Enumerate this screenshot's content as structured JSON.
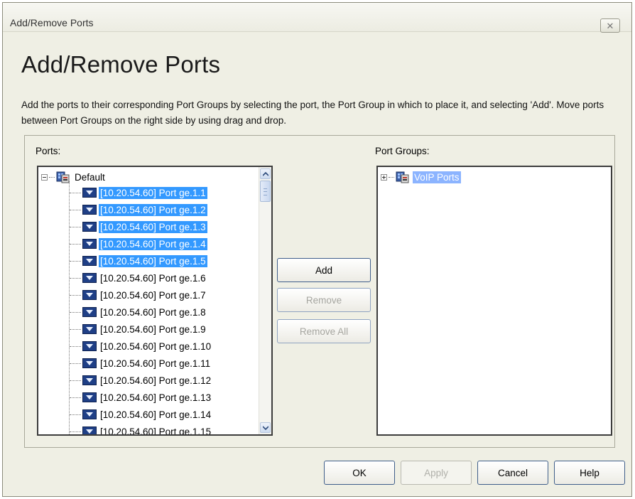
{
  "window": {
    "title": "Add/Remove Ports",
    "close_icon": "close-icon"
  },
  "heading": "Add/Remove Ports",
  "description": "Add the ports to their corresponding Port Groups by selecting the port, the Port Group in which to place it, and selecting 'Add'. Move ports between Port Groups on the right side by using drag and drop.",
  "ports_panel": {
    "label": "Ports:",
    "root": "Default",
    "items": [
      {
        "label": "[10.20.54.60] Port ge.1.1",
        "selected": true
      },
      {
        "label": "[10.20.54.60] Port ge.1.2",
        "selected": true
      },
      {
        "label": "[10.20.54.60] Port ge.1.3",
        "selected": true
      },
      {
        "label": "[10.20.54.60] Port ge.1.4",
        "selected": true
      },
      {
        "label": "[10.20.54.60] Port ge.1.5",
        "selected": true
      },
      {
        "label": "[10.20.54.60] Port ge.1.6",
        "selected": false
      },
      {
        "label": "[10.20.54.60] Port ge.1.7",
        "selected": false
      },
      {
        "label": "[10.20.54.60] Port ge.1.8",
        "selected": false
      },
      {
        "label": "[10.20.54.60] Port ge.1.9",
        "selected": false
      },
      {
        "label": "[10.20.54.60] Port ge.1.10",
        "selected": false
      },
      {
        "label": "[10.20.54.60] Port ge.1.11",
        "selected": false
      },
      {
        "label": "[10.20.54.60] Port ge.1.12",
        "selected": false
      },
      {
        "label": "[10.20.54.60] Port ge.1.13",
        "selected": false
      },
      {
        "label": "[10.20.54.60] Port ge.1.14",
        "selected": false
      },
      {
        "label": "[10.20.54.60] Port ge.1.15",
        "selected": false
      }
    ]
  },
  "port_groups_panel": {
    "label": "Port Groups:",
    "items": [
      {
        "label": "VoIP Ports",
        "selected": true
      }
    ]
  },
  "middle_buttons": {
    "add": "Add",
    "remove": "Remove",
    "remove_all": "Remove All"
  },
  "footer_buttons": {
    "ok": "OK",
    "apply": "Apply",
    "cancel": "Cancel",
    "help": "Help"
  },
  "colors": {
    "selection": "#3399ff",
    "dialog_bg": "#efefe4",
    "button_border": "#3f5e8a"
  }
}
